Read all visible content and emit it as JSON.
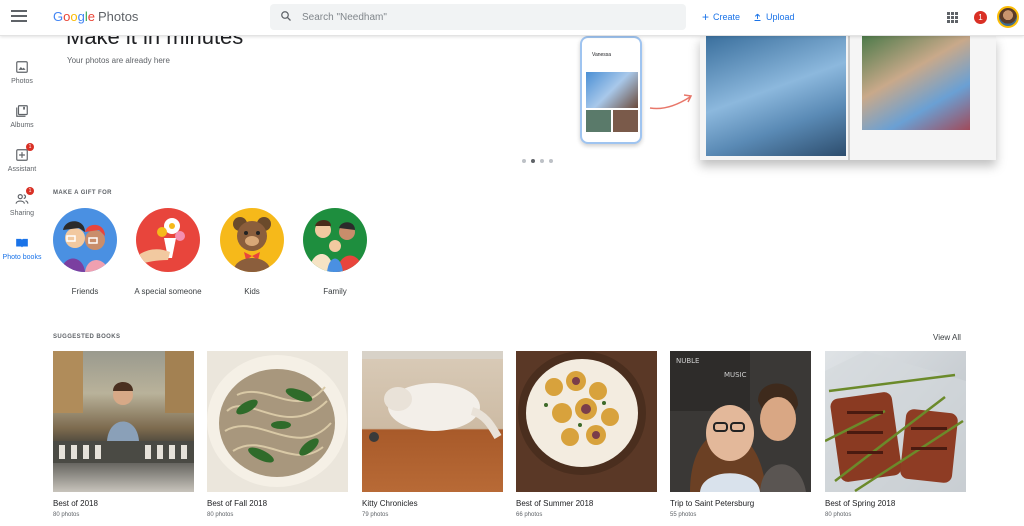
{
  "header": {
    "logo": {
      "google": "Google",
      "product": "Photos"
    },
    "search_placeholder": "Search \"Needham\"",
    "create_label": "Create",
    "upload_label": "Upload",
    "notification_count": "1"
  },
  "sidebar": {
    "items": [
      {
        "label": "Photos",
        "icon": "photo-icon"
      },
      {
        "label": "Albums",
        "icon": "albums-icon"
      },
      {
        "label": "Assistant",
        "icon": "assistant-icon",
        "badge": "1"
      },
      {
        "label": "Sharing",
        "icon": "sharing-icon",
        "badge": "1"
      },
      {
        "label": "Photo books",
        "icon": "book-icon",
        "active": true
      }
    ]
  },
  "hero": {
    "title": "Make it in minutes",
    "subtitle": "Your photos are already here",
    "phone_title": "Vanessa",
    "carousel_dots": 4,
    "carousel_active": 1
  },
  "gifts": {
    "section_label": "MAKE A GIFT FOR",
    "items": [
      {
        "label": "Friends",
        "bg": "#4a90e2"
      },
      {
        "label": "A special someone",
        "bg": "#e8453c"
      },
      {
        "label": "Kids",
        "bg": "#f6b91a"
      },
      {
        "label": "Family",
        "bg": "#1e8e3e"
      }
    ]
  },
  "books": {
    "section_label": "SUGGESTED BOOKS",
    "view_all": "View All",
    "items": [
      {
        "title": "Best of 2018",
        "count": "80 photos"
      },
      {
        "title": "Best of Fall 2018",
        "count": "80 photos"
      },
      {
        "title": "Kitty Chronicles",
        "count": "79 photos"
      },
      {
        "title": "Best of Summer 2018",
        "count": "66 photos"
      },
      {
        "title": "Trip to Saint Petersburg",
        "count": "55 photos"
      },
      {
        "title": "Best of Spring 2018",
        "count": "80 photos"
      }
    ]
  },
  "colors": {
    "accent": "#1a73e8",
    "badge": "#d93025"
  }
}
